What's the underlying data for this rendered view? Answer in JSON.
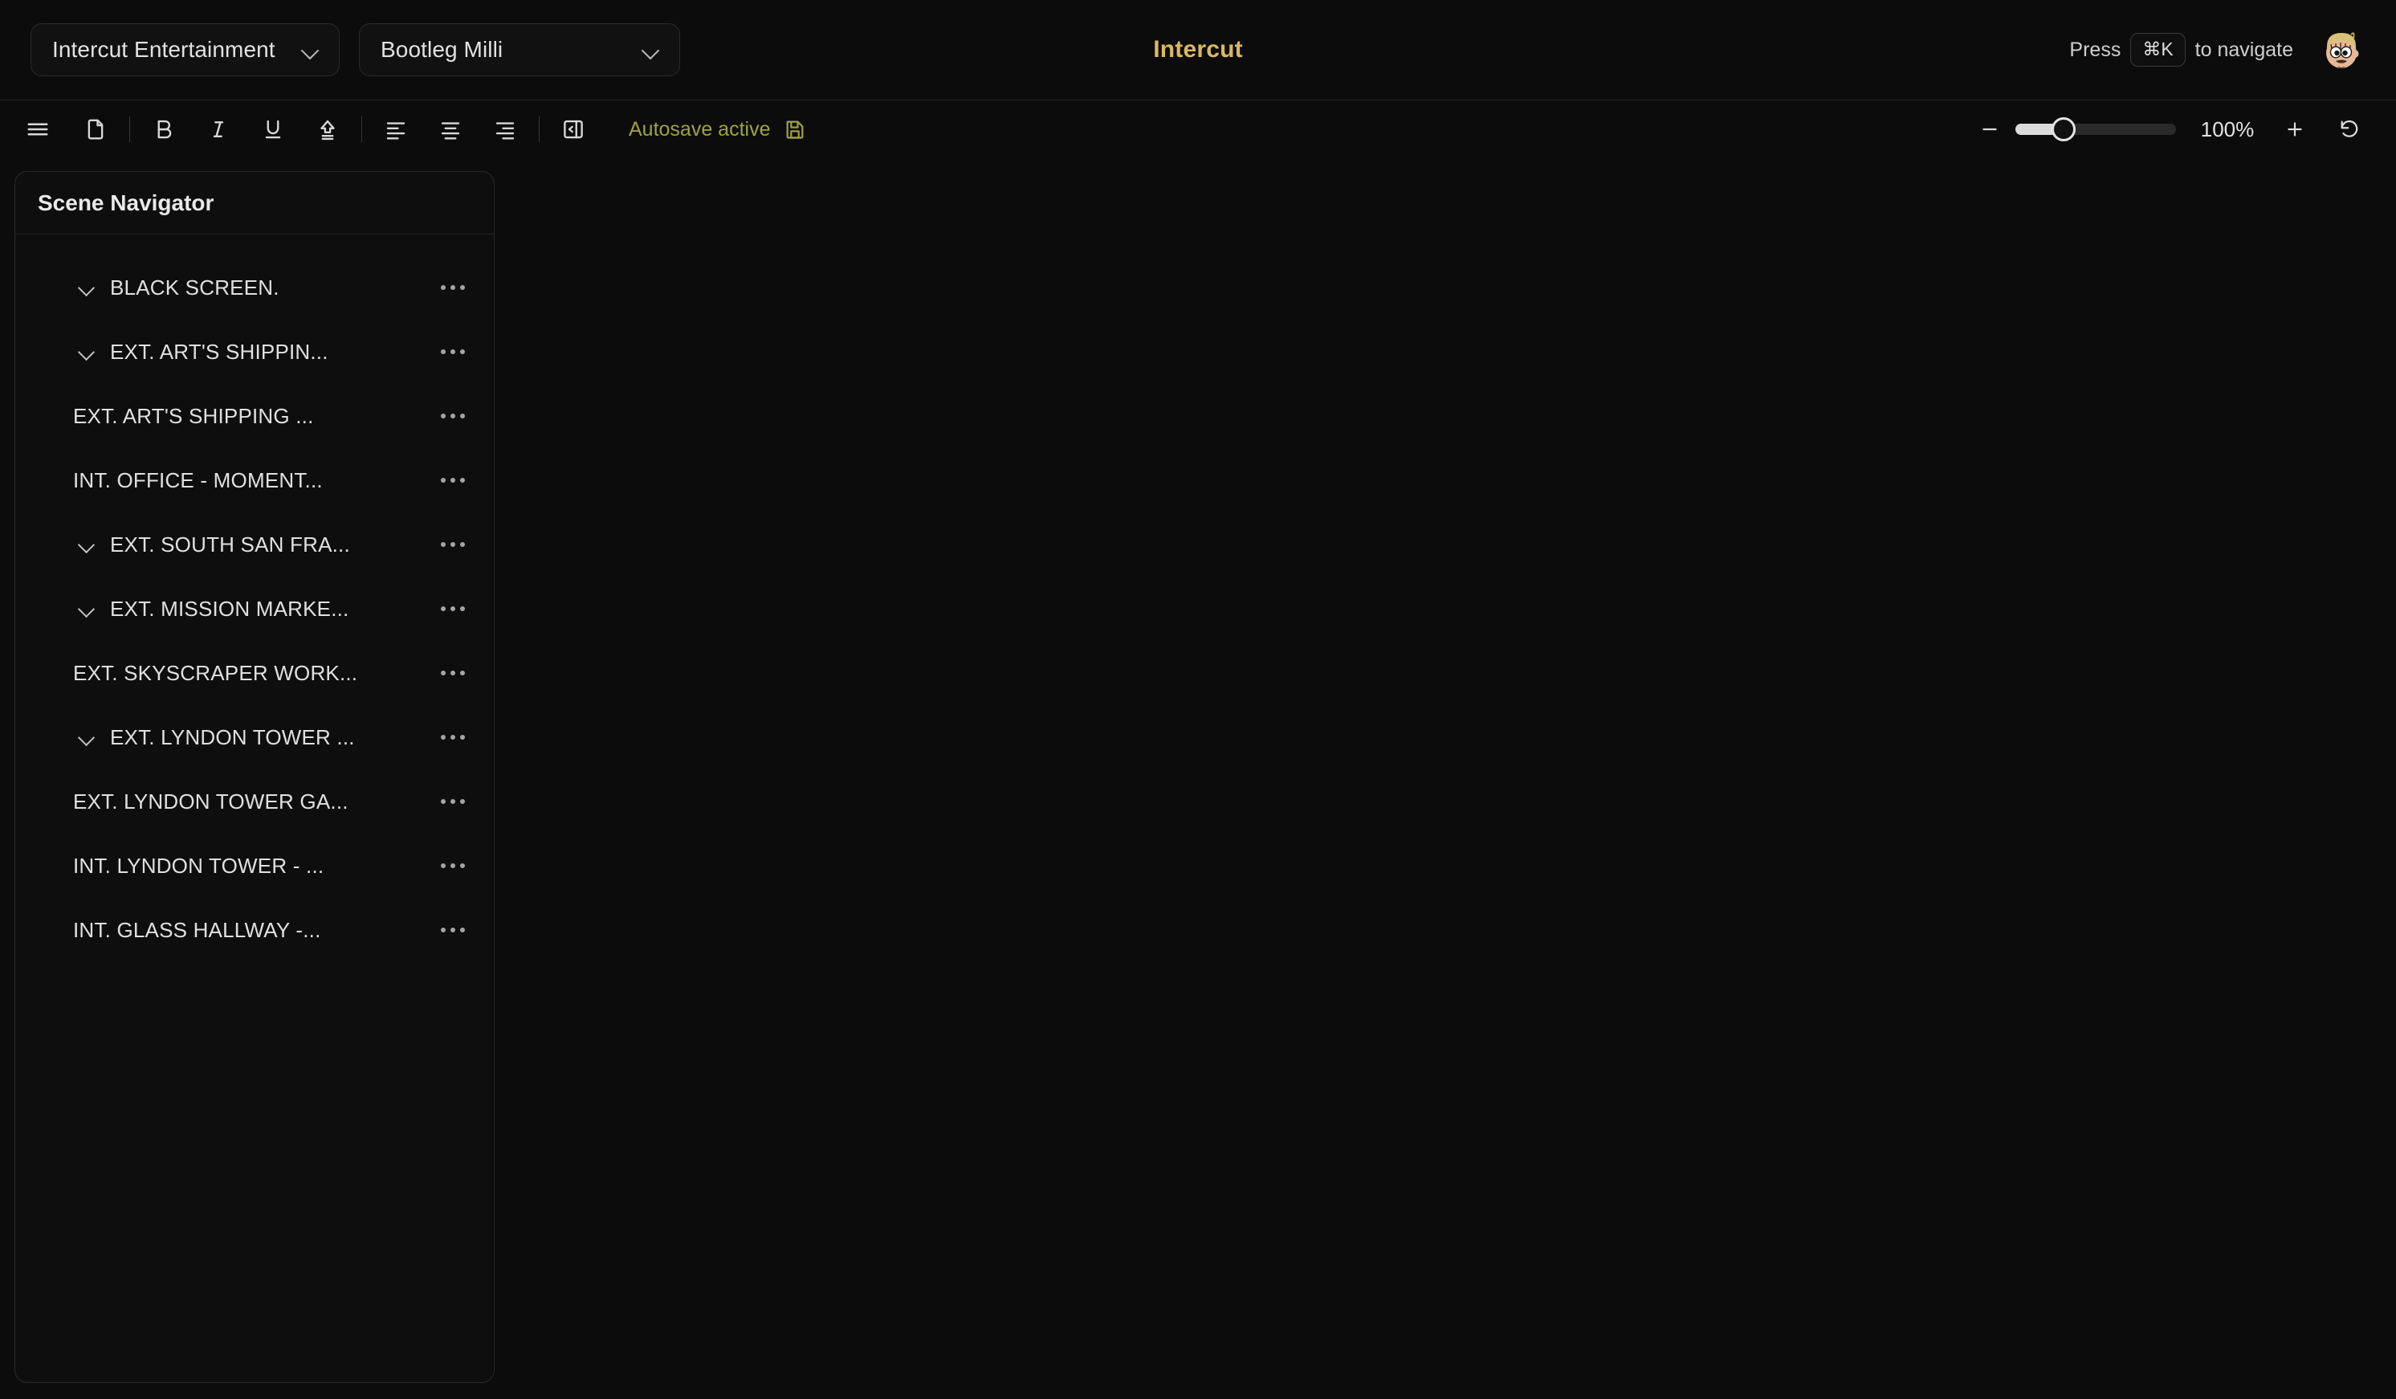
{
  "header": {
    "org_selector": {
      "label": "Intercut Entertainment",
      "icon": "chevron-down-icon"
    },
    "project_selector": {
      "label": "Bootleg Milli",
      "icon": "chevron-down-icon"
    },
    "app_title": "Intercut",
    "nav_hint_prefix": "Press",
    "nav_hint_key": "⌘K",
    "nav_hint_suffix": "to navigate",
    "avatar_alt": "user-avatar"
  },
  "toolbar": {
    "buttons": [
      {
        "name": "menu-icon",
        "title": "Menu"
      },
      {
        "name": "document-icon",
        "title": "Document"
      },
      {
        "name": "bold-icon",
        "title": "Bold",
        "glyph": "B"
      },
      {
        "name": "italic-icon",
        "title": "Italic",
        "glyph": "I"
      },
      {
        "name": "underline-icon",
        "title": "Underline",
        "glyph": "U"
      },
      {
        "name": "arrow-up-line-icon",
        "title": "Move to top"
      },
      {
        "name": "align-left-icon",
        "title": "Align left"
      },
      {
        "name": "align-center-icon",
        "title": "Align center"
      },
      {
        "name": "align-right-icon",
        "title": "Align right"
      },
      {
        "name": "panel-collapse-icon",
        "title": "Toggle panel"
      }
    ],
    "autosave_text": "Autosave active",
    "autosave_icon": "save-icon",
    "zoom": {
      "minus_icon": "minus-icon",
      "plus_icon": "plus-icon",
      "reset_icon": "reset-icon",
      "value": "100%",
      "slider_percent": 30
    }
  },
  "scene_navigator": {
    "title": "Scene Navigator",
    "items": [
      {
        "label": "BLACK SCREEN.",
        "expandable": true
      },
      {
        "label": "EXT. ART'S SHIPPIN...",
        "expandable": true
      },
      {
        "label": "EXT. ART'S SHIPPING ...",
        "expandable": false
      },
      {
        "label": "INT. OFFICE - MOMENT...",
        "expandable": false
      },
      {
        "label": "EXT. SOUTH SAN FRA...",
        "expandable": true
      },
      {
        "label": "EXT. MISSION MARKE...",
        "expandable": true
      },
      {
        "label": "EXT. SKYSCRAPER WORK...",
        "expandable": false
      },
      {
        "label": "EXT. LYNDON TOWER ...",
        "expandable": true
      },
      {
        "label": "EXT. LYNDON TOWER GA...",
        "expandable": false
      },
      {
        "label": "INT. LYNDON TOWER - ...",
        "expandable": false
      },
      {
        "label": "INT. GLASS HALLWAY -...",
        "expandable": false
      }
    ]
  },
  "colors": {
    "background": "#0c0c0c",
    "panel": "#0e0e0e",
    "accent_gold": "#d9b863",
    "autosave_green": "#9fa33f",
    "text_primary": "#e2e2e2",
    "border": "#2a2a2a"
  }
}
